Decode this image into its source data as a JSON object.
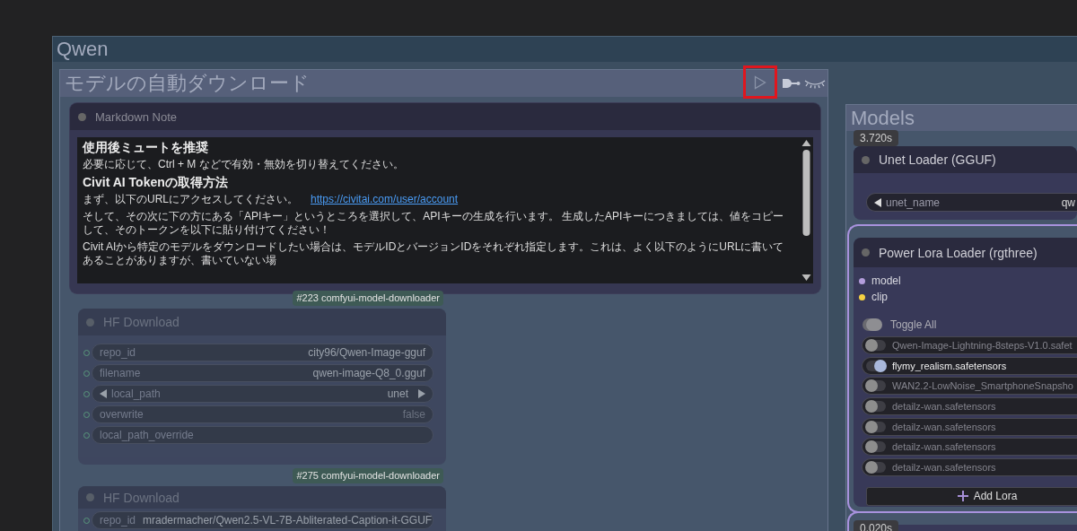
{
  "outer_group": {
    "title": "Qwen"
  },
  "download_group": {
    "title": "モデルの自動ダウンロード",
    "play_button": {
      "highlighted": true
    }
  },
  "markdown_note": {
    "title": "Markdown Note",
    "content": [
      {
        "kind": "heading",
        "text": "使用後ミュートを推奨"
      },
      {
        "kind": "paragraph",
        "text": "必要に応じて、Ctrl + M などで有効・無効を切り替えてください。"
      },
      {
        "kind": "heading",
        "text": "Civit AI Tokenの取得方法"
      },
      {
        "kind": "paragraph",
        "text": "まず、以下のURLにアクセスしてください。",
        "link": "https://civitai.com/user/account"
      },
      {
        "kind": "paragraph",
        "text": "そして、その次に下の方にある「APIキー」というところを選択して、APIキーの生成を行います。 生成したAPIキーにつきましては、値をコピーして、そのトークンを以下に貼り付けてください！"
      },
      {
        "kind": "paragraph",
        "text": "Civit AIから特定のモデルをダウンロードしたい場合は、モデルIDとバージョンIDをそれぞれ指定します。これは、よく以下のようにURLに書いてあることがありますが、書いていない場"
      }
    ]
  },
  "hf_nodes": [
    {
      "badge": "#223 comfyui-model-downloader",
      "title": "HF Download",
      "muted": true,
      "widgets": [
        {
          "kind": "text",
          "label": "repo_id",
          "value": "city96/Qwen-Image-gguf"
        },
        {
          "kind": "text",
          "label": "filename",
          "value": "qwen-image-Q8_0.gguf"
        },
        {
          "kind": "combo",
          "label": "local_path",
          "value": "unet"
        },
        {
          "kind": "toggle",
          "label": "overwrite",
          "value": "false"
        },
        {
          "kind": "text",
          "label": "local_path_override"
        }
      ]
    },
    {
      "badge": "#275 comfyui-model-downloader",
      "title": "HF Download",
      "muted": true,
      "widgets": [
        {
          "kind": "text",
          "label": "repo_id",
          "value": "mradermacher/Qwen2.5-VL-7B-Abliterated-Caption-it-GGUF"
        }
      ]
    }
  ],
  "models_group": {
    "title": "Models",
    "nodes": [
      {
        "kind": "unet",
        "time": "3.720s",
        "title": "Unet Loader (GGUF)",
        "widgets": [
          {
            "kind": "combo",
            "label": "unet_name",
            "value": "qw"
          }
        ]
      },
      {
        "kind": "lora",
        "title": "Power Lora Loader (rgthree)",
        "selected": true,
        "inputs": [
          {
            "name": "model",
            "color": "#b39ddb"
          },
          {
            "name": "clip",
            "color": "#f5d142"
          }
        ],
        "toggle_all": "Toggle All",
        "loras": [
          {
            "name": "Qwen-Image-Lightning-8steps-V1.0.safet",
            "on": false
          },
          {
            "name": "flymy_realism.safetensors",
            "on": true
          },
          {
            "name": "WAN2.2-LowNoise_SmartphoneSnapsho",
            "on": false
          },
          {
            "name": "detailz-wan.safetensors",
            "on": false
          },
          {
            "name": "detailz-wan.safetensors",
            "on": false
          },
          {
            "name": "detailz-wan.safetensors",
            "on": false
          },
          {
            "name": "detailz-wan.safetensors",
            "on": false
          }
        ],
        "add_button": "Add Lora"
      },
      {
        "kind": "partial",
        "time": "0.020s",
        "selected": true
      }
    ]
  }
}
